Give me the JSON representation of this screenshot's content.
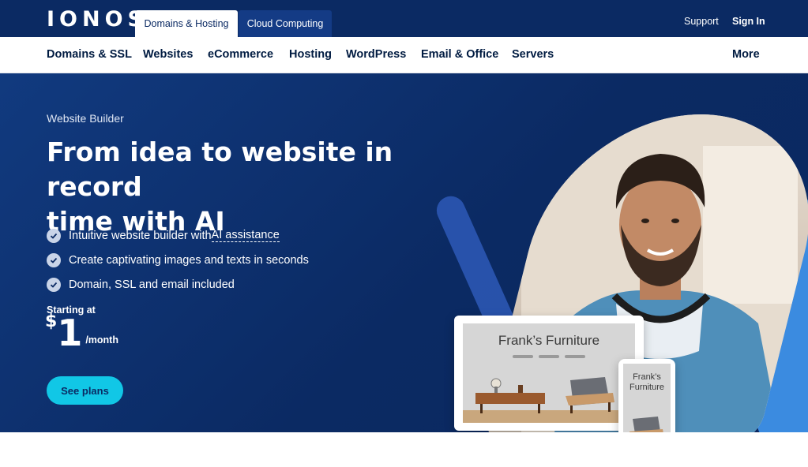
{
  "brand": {
    "logo_text": "IONOS"
  },
  "top_tabs": [
    {
      "label": "Domains & Hosting",
      "active": true
    },
    {
      "label": "Cloud Computing",
      "active": false
    }
  ],
  "top_links": {
    "support": "Support",
    "sign_in": "Sign In"
  },
  "main_nav": {
    "items": [
      "Domains & SSL",
      "Websites",
      "eCommerce",
      "Hosting",
      "WordPress",
      "Email & Office",
      "Servers"
    ],
    "more": "More"
  },
  "hero": {
    "eyebrow": "Website Builder",
    "headline_line1": "From idea to website in record",
    "headline_line2": "time with AI",
    "bullets": [
      {
        "text": "Intuitive website builder with ",
        "link": "AI assistance"
      },
      {
        "text": "Create captivating images and texts in seconds"
      },
      {
        "text": "Domain, SSL and email included"
      }
    ],
    "price_label": "Starting at",
    "price_currency": "$",
    "price_amount": "1",
    "price_period": "/month",
    "cta_label": "See plans"
  },
  "mockup": {
    "laptop_title": "Frank’s Furniture",
    "phone_title_line1": "Frank’s",
    "phone_title_line2": "Furniture"
  },
  "colors": {
    "topbar": "#0b2a63",
    "hero_bg": "#0b2a63",
    "cta": "#11c7e6",
    "accent_blue": "#3b8be0"
  }
}
